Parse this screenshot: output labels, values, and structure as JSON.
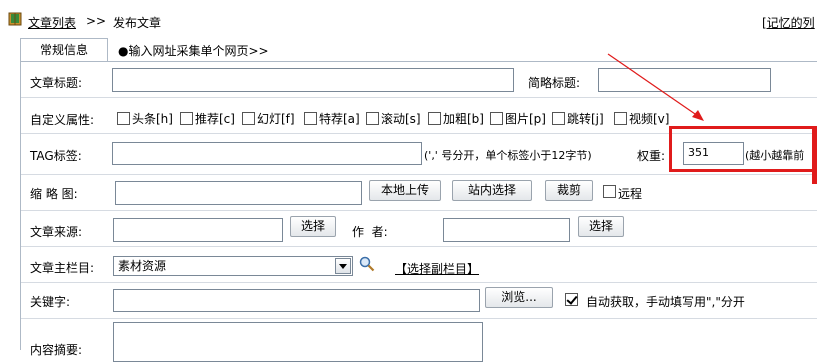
{
  "breadcrumb": {
    "list_link": "文章列表",
    "separator": ">>",
    "current": "发布文章",
    "right_link": "[记忆的列"
  },
  "tabs": [
    {
      "label": "常规信息",
      "active": true
    },
    {
      "label": "●输入网址采集单个网页>>",
      "active": false
    }
  ],
  "form": {
    "title": {
      "label": "文章标题:",
      "value": ""
    },
    "short_title": {
      "label": "简略标题:",
      "value": ""
    },
    "attributes": {
      "label": "自定义属性:",
      "options": [
        {
          "label": "头条[h]",
          "checked": false
        },
        {
          "label": "推荐[c]",
          "checked": false
        },
        {
          "label": "幻灯[f]",
          "checked": false
        },
        {
          "label": "特荐[a]",
          "checked": false
        },
        {
          "label": "滚动[s]",
          "checked": false
        },
        {
          "label": "加粗[b]",
          "checked": false
        },
        {
          "label": "图片[p]",
          "checked": false
        },
        {
          "label": "跳转[j]",
          "checked": false
        },
        {
          "label": "视频[v]",
          "checked": false
        }
      ]
    },
    "tags": {
      "label": "TAG标签:",
      "value": "",
      "hint": "(',' 号分开，单个标签小于12字节)"
    },
    "weight": {
      "label": "权重:",
      "value": "351",
      "hint": "(越小越靠前"
    },
    "thumbnail": {
      "label": "缩 略 图:",
      "value": "",
      "upload_button": "本地上传",
      "site_select_button": "站内选择",
      "crop_button": "裁剪",
      "remote_label": "远程",
      "remote_checked": false
    },
    "source": {
      "label": "文章来源:",
      "value": "",
      "select_button": "选择"
    },
    "author": {
      "label": "作  者:",
      "value": "",
      "select_button": "选择"
    },
    "main_column": {
      "label": "文章主栏目:",
      "selected": "素材资源",
      "sub_column_link": "【选择副栏目】"
    },
    "keywords": {
      "label": "关键字:",
      "value": "",
      "browse_button": "浏览...",
      "auto_label": "自动获取，手动填写用\",\"分开",
      "auto_checked": true
    },
    "summary": {
      "label": "内容摘要:",
      "value": ""
    }
  },
  "colors": {
    "annotation_red": "#e01b1b",
    "border": "#aeb9c6"
  },
  "icons": {
    "book": "book-icon",
    "search": "search-icon"
  }
}
